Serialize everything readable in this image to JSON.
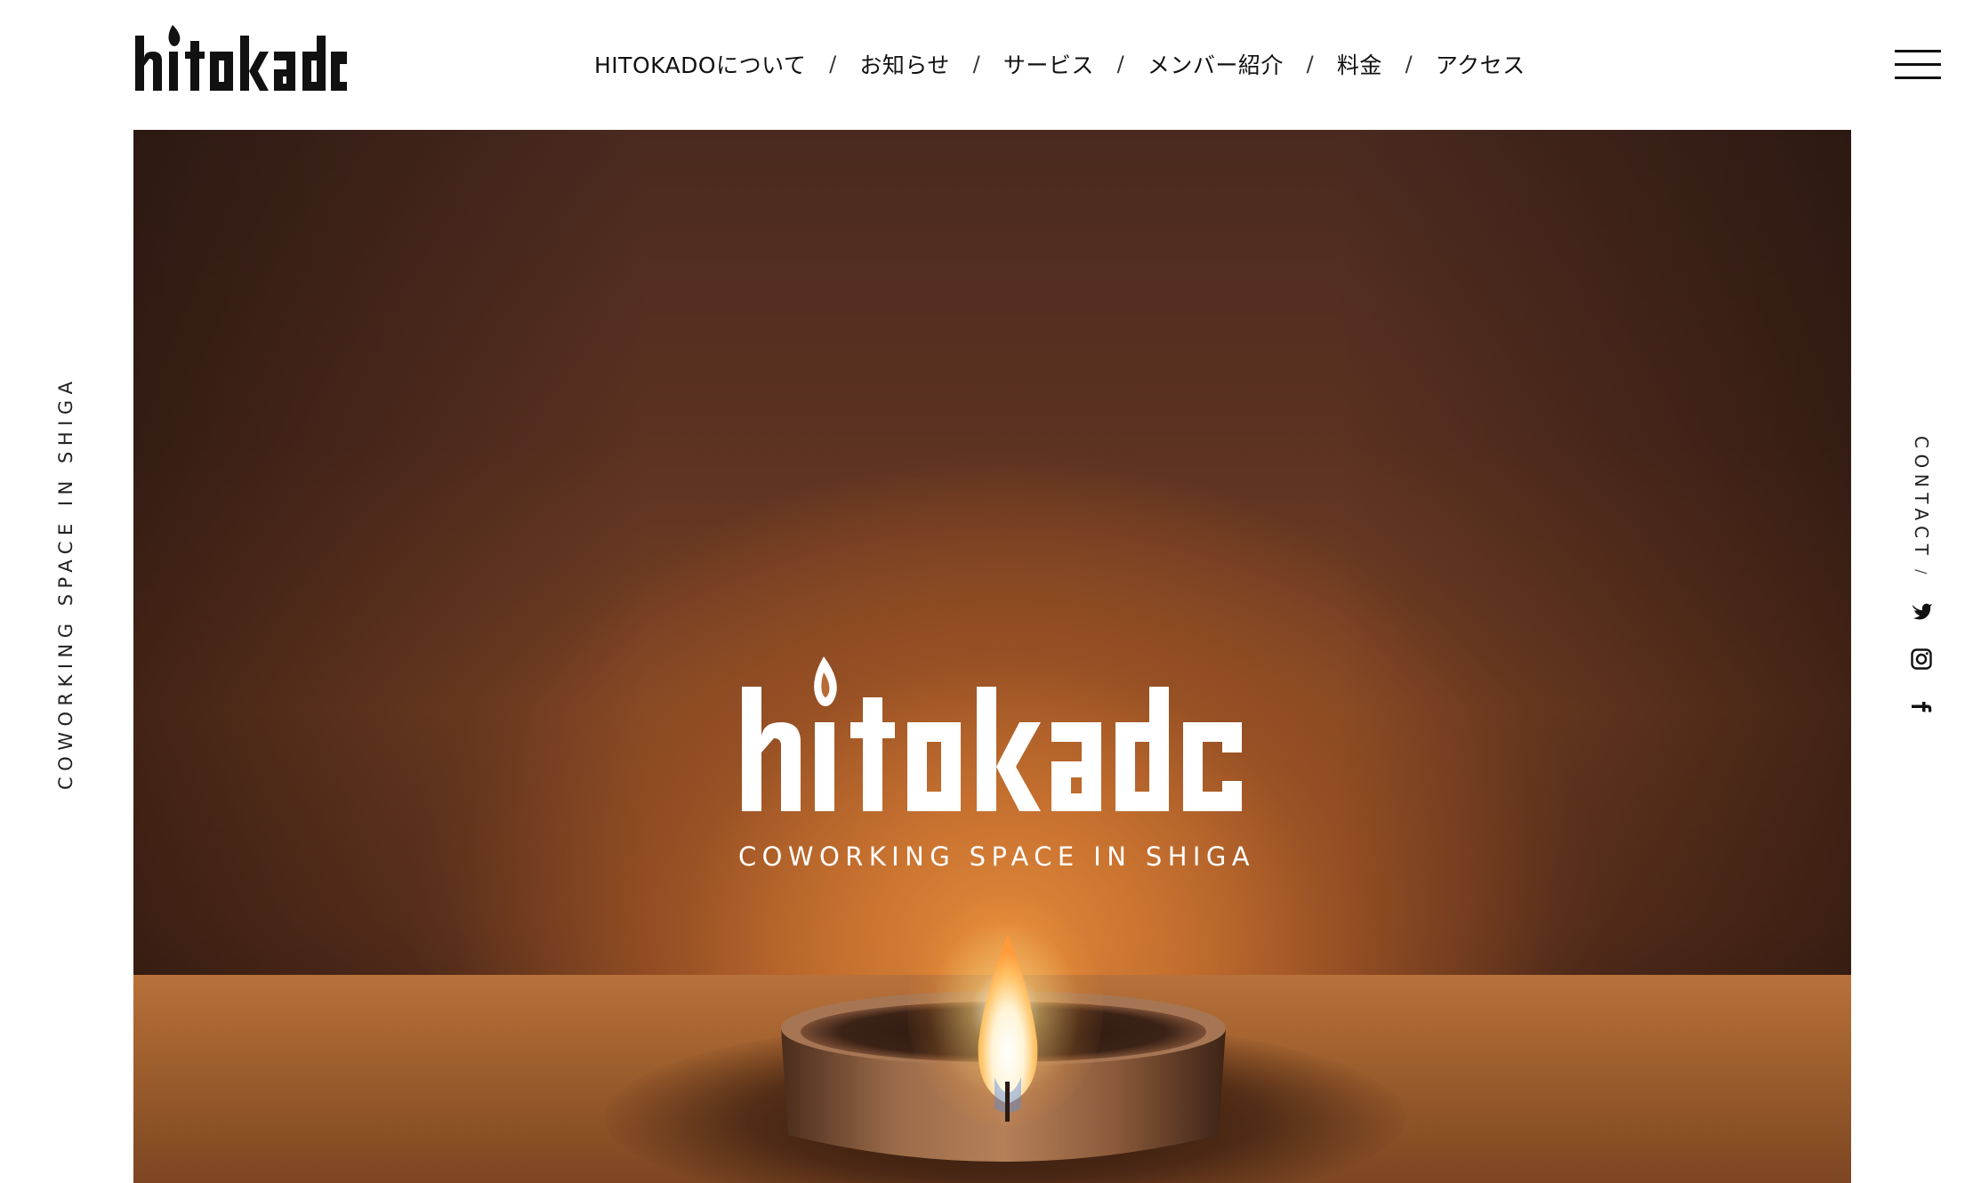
{
  "brand": {
    "logo_text": "hitokado"
  },
  "nav": {
    "items": [
      {
        "label": "HITOKADOについて"
      },
      {
        "label": "お知らせ"
      },
      {
        "label": "サービス"
      },
      {
        "label": "メンバー紹介"
      },
      {
        "label": "料金"
      },
      {
        "label": "アクセス"
      }
    ],
    "separator": "/"
  },
  "side": {
    "tagline": "COWORKING SPACE IN SHIGA",
    "contact_label": "CONTACT",
    "contact_separator": "/",
    "social": [
      {
        "icon": "bird-icon"
      },
      {
        "icon": "instagram-icon"
      },
      {
        "icon": "facebook-icon"
      }
    ]
  },
  "hero": {
    "logo_text": "hitokado",
    "tagline": "COWORKING SPACE IN SHIGA"
  },
  "colors": {
    "text": "#111111",
    "background": "#ffffff",
    "hero_warm": "#b9652a"
  }
}
